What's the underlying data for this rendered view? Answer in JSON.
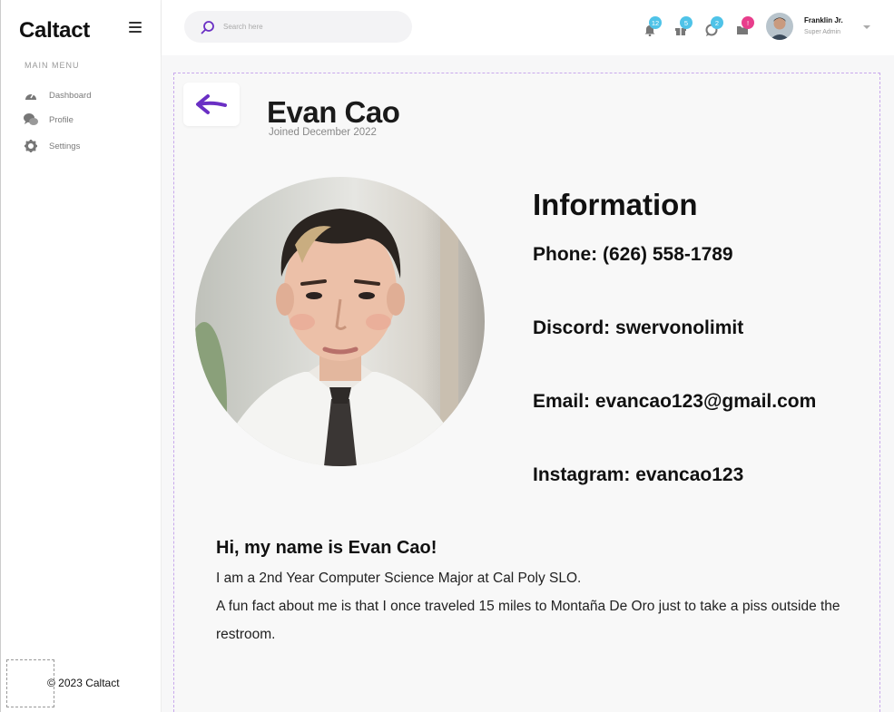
{
  "sidebar": {
    "logo": "Caltact",
    "menu_label": "MAIN MENU",
    "items": [
      {
        "label": "Dashboard",
        "icon": "dashboard-gauge-icon"
      },
      {
        "label": "Profile",
        "icon": "profile-chat-icon"
      },
      {
        "label": "Settings",
        "icon": "gear-icon"
      }
    ],
    "footer": "© 2023 Caltact"
  },
  "topbar": {
    "search": {
      "placeholder": "Search here",
      "value": ""
    },
    "notifications": [
      {
        "icon": "bell-icon",
        "count": "12",
        "color": "#4fc3e8"
      },
      {
        "icon": "gift-icon",
        "count": "5",
        "color": "#4fc3e8"
      },
      {
        "icon": "chat-bubble-icon",
        "count": "2",
        "color": "#4fc3e8"
      },
      {
        "icon": "folder-icon",
        "count": "!",
        "color": "#e83e8c"
      }
    ],
    "user": {
      "name": "Franklin Jr.",
      "role": "Super Admin"
    }
  },
  "profile": {
    "name": "Evan Cao",
    "joined": "Joined December 2022",
    "info_title": "Information",
    "fields": [
      {
        "label": "Phone",
        "value": "(626) 558-1789",
        "text": "Phone: (626) 558-1789"
      },
      {
        "label": "Discord",
        "value": "swervonolimit",
        "text": "Discord: swervonolimit"
      },
      {
        "label": "Email",
        "value": "evancao123@gmail.com",
        "text": "Email: evancao123@gmail.com"
      },
      {
        "label": "Instagram",
        "value": "evancao123",
        "text": "Instagram: evancao123"
      }
    ],
    "bio": {
      "heading": "Hi, my name is Evan Cao!",
      "line1": "I am a 2nd Year Computer Science Major at Cal Poly SLO.",
      "line2": "A fun fact about me is that I once traveled 15 miles to Montaña De Oro just to take a piss outside the restroom."
    }
  },
  "colors": {
    "accent": "#6a2fc4",
    "badge_blue": "#4fc3e8",
    "badge_pink": "#e83e8c",
    "card_border": "#c8a8ec"
  }
}
